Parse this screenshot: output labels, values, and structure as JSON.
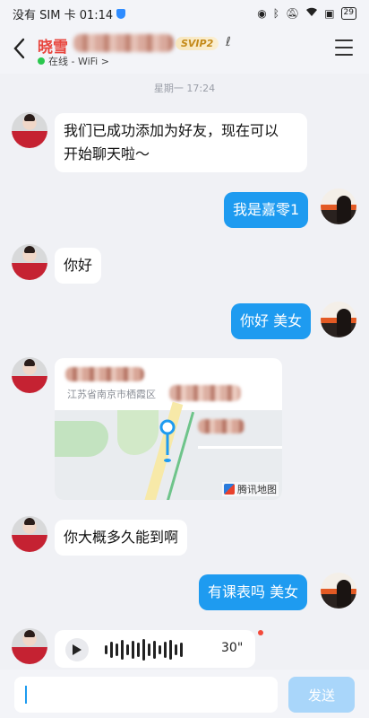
{
  "status_bar": {
    "carrier_time": "没有 SIM 卡 01:14",
    "battery": "29",
    "icons": [
      "shield-icon",
      "eye-icon",
      "bluetooth-icon",
      "mute-icon",
      "wifi-icon",
      "battery-saver-icon",
      "battery-icon"
    ]
  },
  "header": {
    "name": "晓雪",
    "vip_badge": "SVIP2",
    "online_status": "在线 - WiFi >",
    "online_color": "#2ac74e",
    "name_color": "#e8463e"
  },
  "timestamp": "星期一 17:24",
  "messages": [
    {
      "side": "in",
      "type": "text",
      "text_line1": "我们已成功添加为好友，现在可以",
      "text_line2": "开始聊天啦～"
    },
    {
      "side": "out",
      "type": "text",
      "text": "我是嘉零1"
    },
    {
      "side": "in",
      "type": "text",
      "text": "你好"
    },
    {
      "side": "out",
      "type": "text",
      "text": "你好 美女"
    },
    {
      "side": "in",
      "type": "location",
      "address": "江苏省南京市栖霞区",
      "map_brand": "腾讯地图"
    },
    {
      "side": "in",
      "type": "text",
      "text": "你大概多久能到啊"
    },
    {
      "side": "out",
      "type": "text",
      "text": "有课表吗 美女"
    },
    {
      "side": "in",
      "type": "voice",
      "duration": "30\""
    }
  ],
  "input": {
    "send_label": "发送"
  },
  "colors": {
    "outgoing_bubble": "#1e9bf0",
    "incoming_bubble": "#ffffff",
    "background": "#f0f1f5"
  }
}
